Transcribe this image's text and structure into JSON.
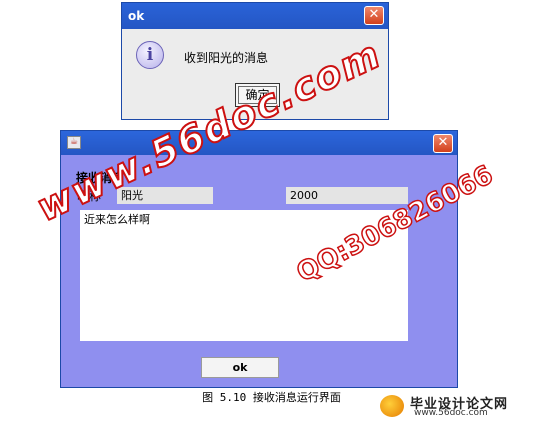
{
  "dialog": {
    "title": "ok",
    "message": "收到阳光的消息",
    "confirm_label": "确定",
    "close_glyph": "✕",
    "icon": "info-icon"
  },
  "main_window": {
    "close_glyph": "✕",
    "section_label": "接收消息",
    "nick_label": "昵称",
    "nick_value": "阳光",
    "number_value": "2000",
    "message_text": "近来怎么样啊",
    "ok_label": "ok",
    "background_color": "#8f8fef"
  },
  "caption": "图 5.10 接收消息运行界面",
  "watermarks": {
    "site": "www.56doc.com",
    "qq": "QQ:306826066"
  },
  "logo": {
    "name": "毕业设计论文网",
    "url": "www.56doc.com"
  }
}
